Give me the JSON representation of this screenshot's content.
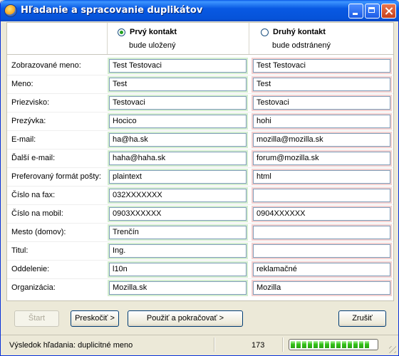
{
  "window": {
    "title": "Hľadanie a spracovanie duplikátov"
  },
  "header": {
    "contact1": {
      "label": "Prvý kontakt",
      "sublabel": "bude uložený",
      "selected": true
    },
    "contact2": {
      "label": "Druhý kontakt",
      "sublabel": "bude odstránený",
      "selected": false
    }
  },
  "rows": [
    {
      "label": "Zobrazované meno:",
      "v1": "Test Testovaci",
      "v2": "Test Testovaci"
    },
    {
      "label": "Meno:",
      "v1": "Test",
      "v2": "Test"
    },
    {
      "label": "Priezvisko:",
      "v1": "Testovaci",
      "v2": "Testovaci"
    },
    {
      "label": "Prezývka:",
      "v1": "Hocico",
      "v2": "hohi"
    },
    {
      "label": "E-mail:",
      "v1": "ha@ha.sk",
      "v2": "mozilla@mozilla.sk"
    },
    {
      "label": "Ďalší e-mail:",
      "v1": "haha@haha.sk",
      "v2": "forum@mozilla.sk"
    },
    {
      "label": "Preferovaný formát pošty:",
      "v1": "plaintext",
      "v2": "html"
    },
    {
      "label": "Číslo na fax:",
      "v1": "032XXXXXXX",
      "v2": ""
    },
    {
      "label": "Číslo na mobil:",
      "v1": "0903XXXXXX",
      "v2": "0904XXXXXX"
    },
    {
      "label": "Mesto (domov):",
      "v1": "Trenčín",
      "v2": ""
    },
    {
      "label": "Titul:",
      "v1": "Ing.",
      "v2": ""
    },
    {
      "label": "Oddelenie:",
      "v1": "l10n",
      "v2": "reklamačné"
    },
    {
      "label": "Organizácia:",
      "v1": "Mozilla.sk",
      "v2": "Mozilla"
    }
  ],
  "buttons": {
    "start": "Štart",
    "skip": "Preskočiť >",
    "apply": "Použiť a pokračovať >",
    "cancel": "Zrušiť"
  },
  "status": {
    "text": "Výsledok hľadania: duplicitné meno",
    "count": "173",
    "progress_fraction": 0.9
  },
  "colors": {
    "keep_highlight": "#d4eed0",
    "remove_highlight": "#f3d0cf",
    "titlebar": "#0653d9"
  }
}
